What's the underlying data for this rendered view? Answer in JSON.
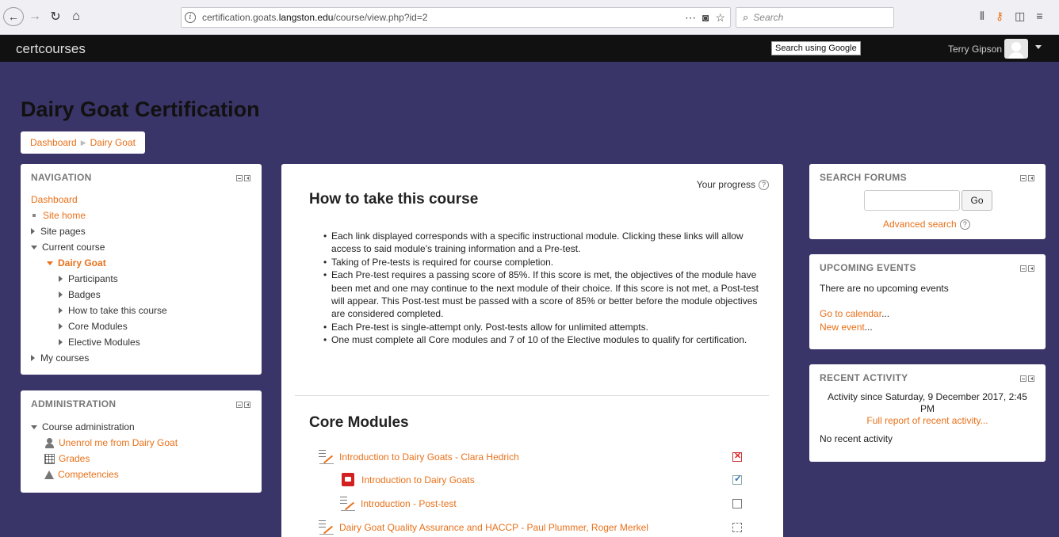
{
  "browser": {
    "url_prefix": "certification.goats.",
    "url_domain": "langston.edu",
    "url_path": "/course/view.php?id=2",
    "search_placeholder": "Search"
  },
  "navbar": {
    "brand": "certcourses",
    "search_tooltip": "Search using Google",
    "user_name": "Terry Gipson"
  },
  "page": {
    "title": "Dairy Goat Certification",
    "breadcrumb": [
      "Dashboard",
      "Dairy Goat"
    ]
  },
  "navigation": {
    "title": "NAVIGATION",
    "dashboard": "Dashboard",
    "site_home": "Site home",
    "site_pages": "Site pages",
    "current_course": "Current course",
    "course": "Dairy Goat",
    "course_items": [
      "Participants",
      "Badges",
      "How to take this course",
      "Core Modules",
      "Elective Modules"
    ],
    "my_courses": "My courses"
  },
  "administration": {
    "title": "ADMINISTRATION",
    "course_admin": "Course administration",
    "items": [
      "Unenrol me from Dairy Goat",
      "Grades",
      "Competencies"
    ]
  },
  "main": {
    "progress_label": "Your progress",
    "section1_title": "How to take this course",
    "bullets": [
      "Each link displayed corresponds with a specific instructional module. Clicking these links will allow access to said module's training information and a Pre-test.",
      "Taking of Pre-tests is required for course completion.",
      "Each Pre-test requires a passing score of 85%. If this score is met, the objectives of the module have been met and one may continue to the next module of their choice. If this score is not met, a Post-test will appear. This Post-test must be passed with a score of 85% or better before the module objectives are considered completed.",
      "Each Pre-test is single-attempt only. Post-tests allow for unlimited attempts.",
      "One must complete all Core modules and 7 of 10 of the Elective modules to qualify for certification."
    ],
    "section2_title": "Core Modules",
    "activities": [
      {
        "label": "Introduction to Dairy Goats - Clara Hedrich",
        "type": "quiz",
        "status": "fail"
      },
      {
        "label": "Introduction to Dairy Goats",
        "type": "pdf",
        "status": "done"
      },
      {
        "label": "Introduction - Post-test",
        "type": "quiz",
        "status": "empty"
      },
      {
        "label": "Dairy Goat Quality Assurance and HACCP - Paul Plummer, Roger Merkel",
        "type": "quiz",
        "status": "dashed"
      }
    ]
  },
  "search_forums": {
    "title": "SEARCH FORUMS",
    "go": "Go",
    "advanced": "Advanced search"
  },
  "upcoming_events": {
    "title": "UPCOMING EVENTS",
    "none": "There are no upcoming events",
    "calendar_link": "Go to calendar",
    "new_event_link": "New event",
    "ellipsis": "..."
  },
  "recent_activity": {
    "title": "RECENT ACTIVITY",
    "since_line1": "Activity since Saturday, 9 December 2017, 2:45",
    "since_line2": "PM",
    "full_report": "Full report of recent activity...",
    "none": "No recent activity"
  },
  "colors": {
    "accent": "#e8711a",
    "page_bg": "#3a3568",
    "navbar_bg": "#111111"
  }
}
